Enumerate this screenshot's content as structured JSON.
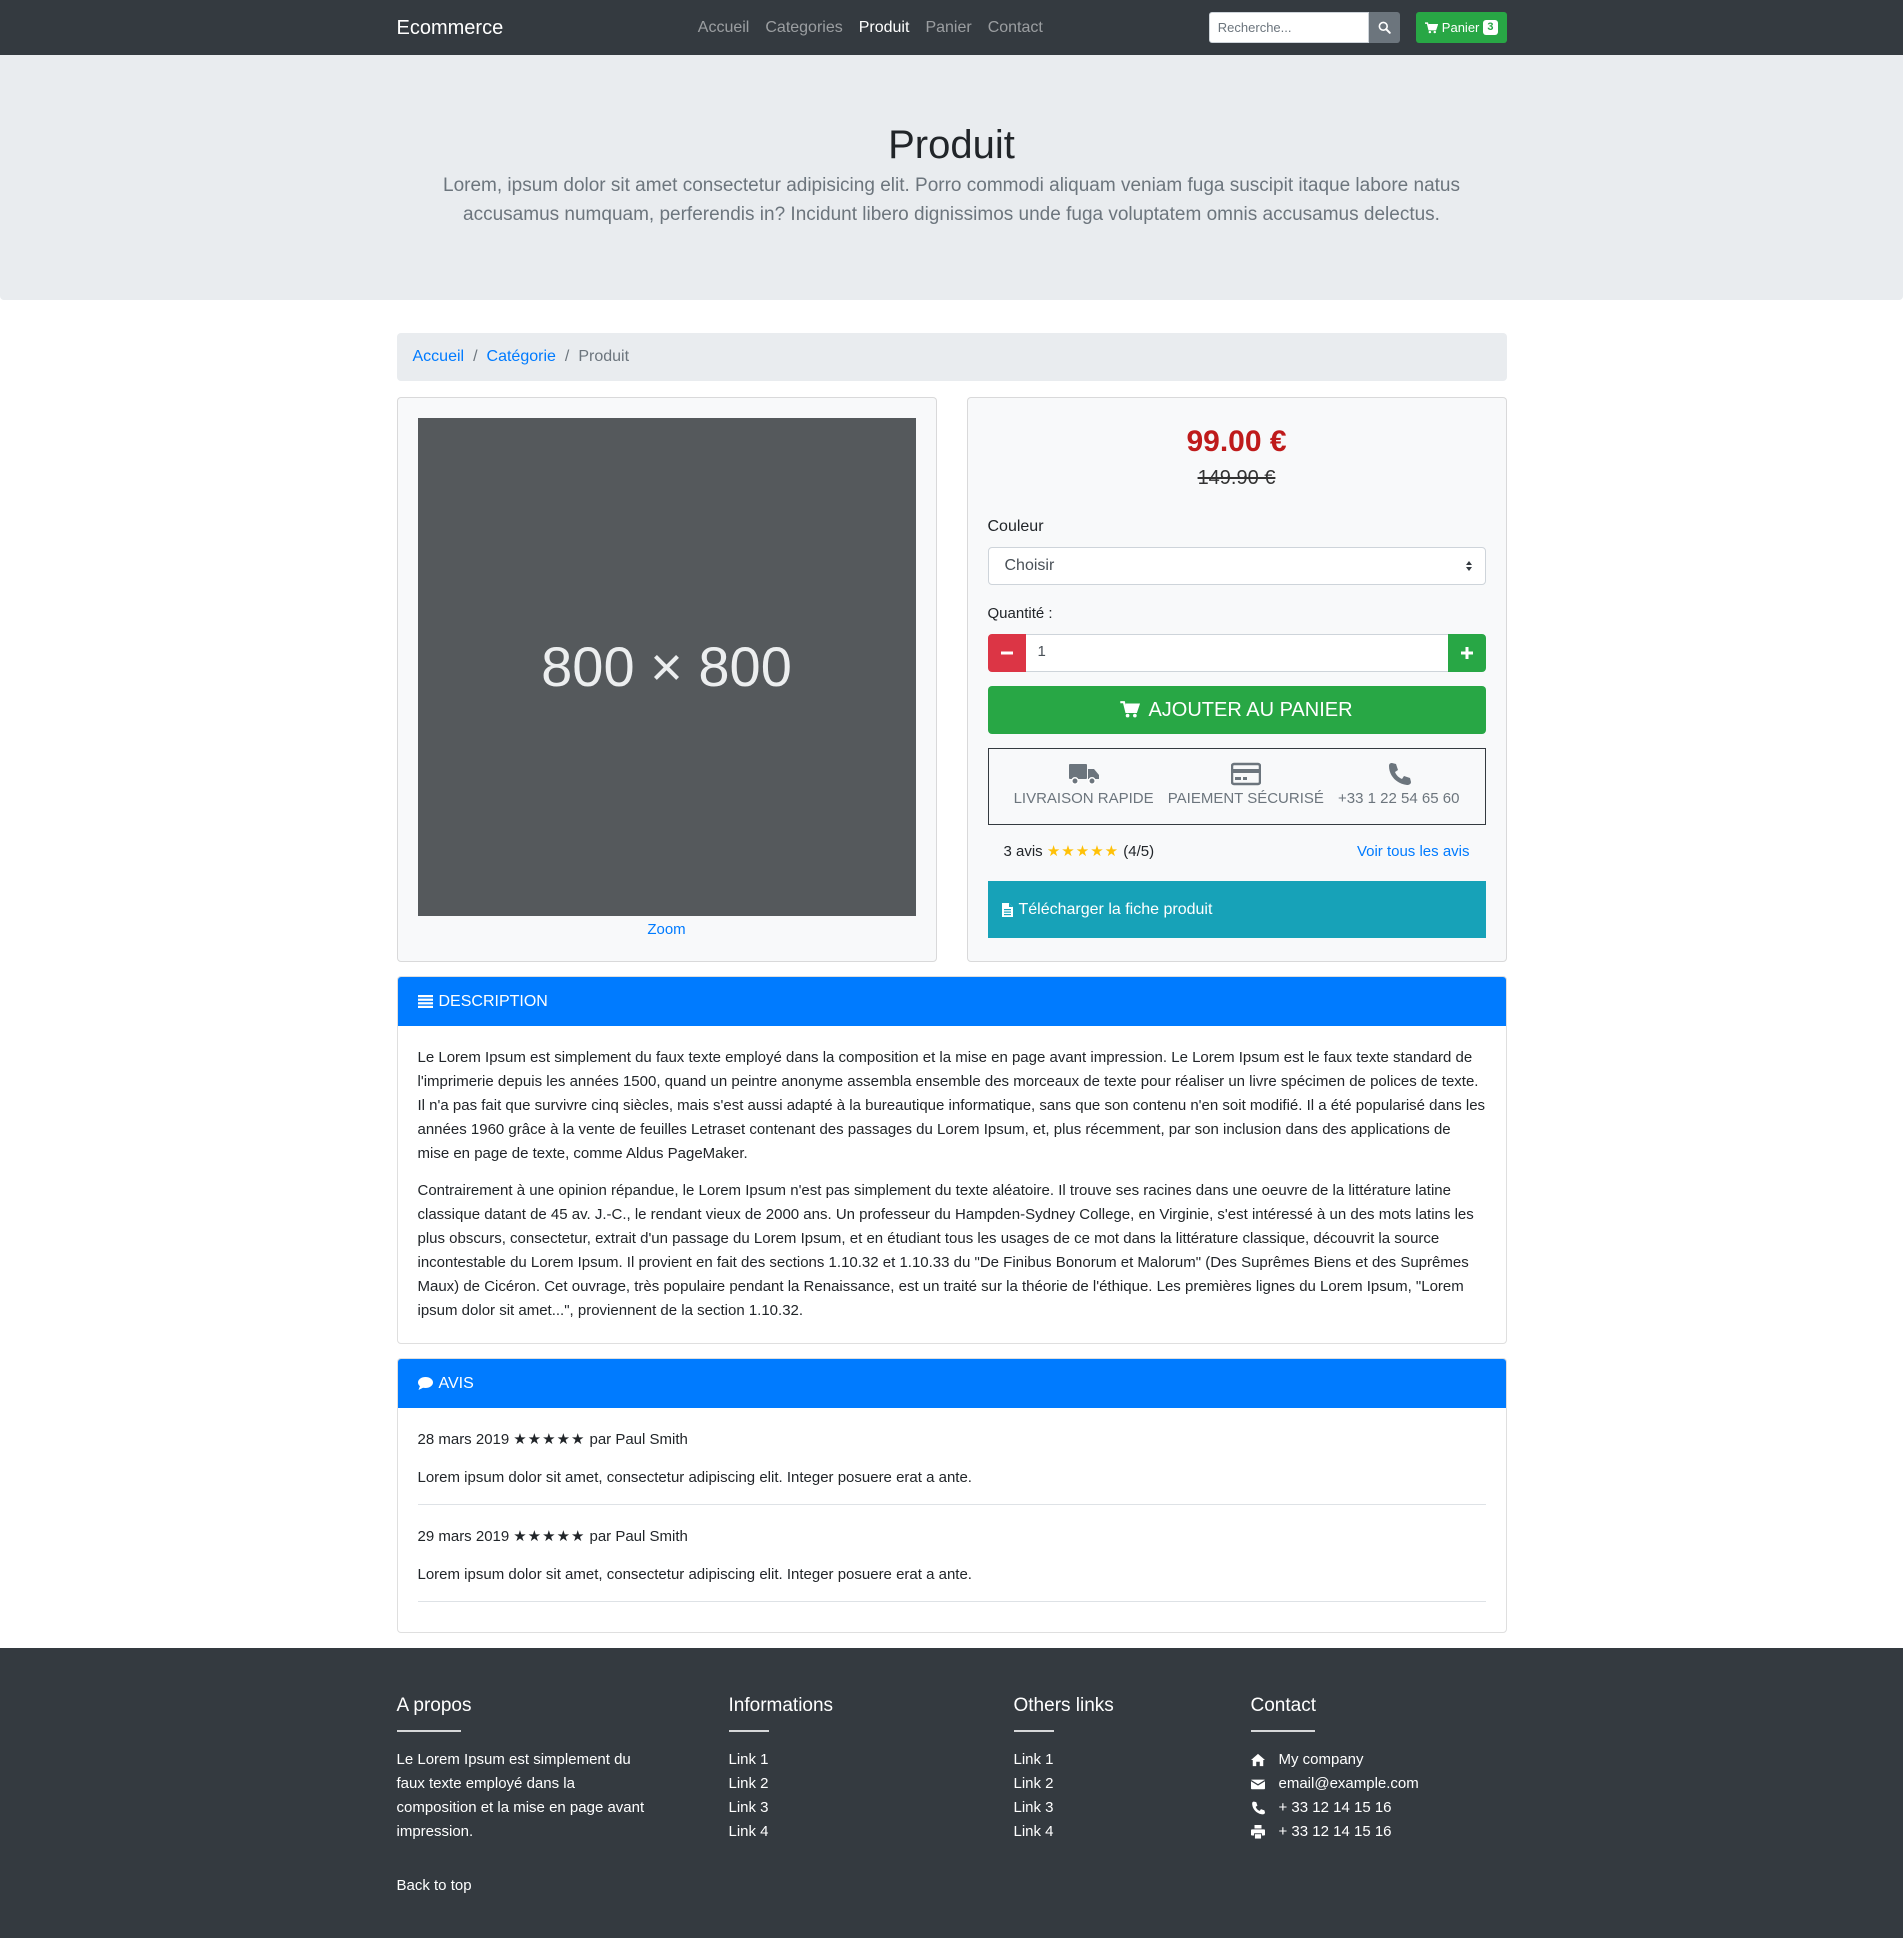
{
  "navbar": {
    "brand": "Ecommerce",
    "links": [
      "Accueil",
      "Categories",
      "Produit",
      "Panier",
      "Contact"
    ],
    "active": "Produit",
    "search_placeholder": "Recherche...",
    "cart_label": "Panier",
    "cart_count": "3"
  },
  "jumbotron": {
    "title": "Produit",
    "lead": "Lorem, ipsum dolor sit amet consectetur adipisicing elit. Porro commodi aliquam veniam fuga suscipit itaque labore natus accusamus numquam, perferendis in? Incidunt libero dignissimos unde fuga voluptatem omnis accusamus delectus."
  },
  "breadcrumb": {
    "items": [
      "Accueil",
      "Catégorie"
    ],
    "current": "Produit"
  },
  "product": {
    "image_placeholder": "800 × 800",
    "zoom_label": "Zoom",
    "price": "99.00 €",
    "old_price": "149.90 €",
    "color_label": "Couleur",
    "color_selected": "Choisir",
    "quantity_label": "Quantité :",
    "quantity_value": "1",
    "add_to_cart": "AJOUTER AU PANIER",
    "features": [
      {
        "icon": "truck-icon",
        "label": "LIVRAISON RAPIDE"
      },
      {
        "icon": "credit-card-icon",
        "label": "PAIEMENT SÉCURISÉ"
      },
      {
        "icon": "phone-icon",
        "label": "+33 1 22 54 65 60"
      }
    ],
    "reviews_count": "3 avis",
    "rating": 4,
    "rating_text": "(4/5)",
    "see_all_reviews": "Voir tous les avis",
    "download_label": "Télécharger la fiche produit"
  },
  "description": {
    "title": "DESCRIPTION",
    "paragraphs": [
      "Le Lorem Ipsum est simplement du faux texte employé dans la composition et la mise en page avant impression. Le Lorem Ipsum est le faux texte standard de l'imprimerie depuis les années 1500, quand un peintre anonyme assembla ensemble des morceaux de texte pour réaliser un livre spécimen de polices de texte. Il n'a pas fait que survivre cinq siècles, mais s'est aussi adapté à la bureautique informatique, sans que son contenu n'en soit modifié. Il a été popularisé dans les années 1960 grâce à la vente de feuilles Letraset contenant des passages du Lorem Ipsum, et, plus récemment, par son inclusion dans des applications de mise en page de texte, comme Aldus PageMaker.",
      "Contrairement à une opinion répandue, le Lorem Ipsum n'est pas simplement du texte aléatoire. Il trouve ses racines dans une oeuvre de la littérature latine classique datant de 45 av. J.-C., le rendant vieux de 2000 ans. Un professeur du Hampden-Sydney College, en Virginie, s'est intéressé à un des mots latins les plus obscurs, consectetur, extrait d'un passage du Lorem Ipsum, et en étudiant tous les usages de ce mot dans la littérature classique, découvrit la source incontestable du Lorem Ipsum. Il provient en fait des sections 1.10.32 et 1.10.33 du \"De Finibus Bonorum et Malorum\" (Des Suprêmes Biens et des Suprêmes Maux) de Cicéron. Cet ouvrage, très populaire pendant la Renaissance, est un traité sur la théorie de l'éthique. Les premières lignes du Lorem Ipsum, \"Lorem ipsum dolor sit amet...\", proviennent de la section 1.10.32."
    ]
  },
  "reviews": {
    "title": "AVIS",
    "items": [
      {
        "date": "28 mars 2019",
        "rating": 5,
        "author": "par Paul Smith",
        "text": "Lorem ipsum dolor sit amet, consectetur adipiscing elit. Integer posuere erat a ante."
      },
      {
        "date": "29 mars 2019",
        "rating": 5,
        "author": "par Paul Smith",
        "text": "Lorem ipsum dolor sit amet, consectetur adipiscing elit. Integer posuere erat a ante."
      }
    ]
  },
  "footer": {
    "about_title": "A propos",
    "about_text": "Le Lorem Ipsum est simplement du faux texte employé dans la composition et la mise en page avant impression.",
    "info_title": "Informations",
    "info_links": [
      "Link 1",
      "Link 2",
      "Link 3",
      "Link 4"
    ],
    "others_title": "Others links",
    "others_links": [
      "Link 1",
      "Link 2",
      "Link 3",
      "Link 4"
    ],
    "contact_title": "Contact",
    "contact_items": [
      {
        "icon": "home-icon",
        "text": "My company"
      },
      {
        "icon": "envelope-icon",
        "text": "email@example.com"
      },
      {
        "icon": "phone-icon",
        "text": "+ 33 12 14 15 16"
      },
      {
        "icon": "print-icon",
        "text": "+ 33 12 14 15 16"
      }
    ],
    "back_to_top": "Back to top"
  },
  "colors": {
    "navbar": "#343a40",
    "primary": "#007bff",
    "success": "#28a745",
    "danger": "#dc3545",
    "info": "#17a2b8",
    "price": "#bf1b1b",
    "star": "#ffc107"
  }
}
